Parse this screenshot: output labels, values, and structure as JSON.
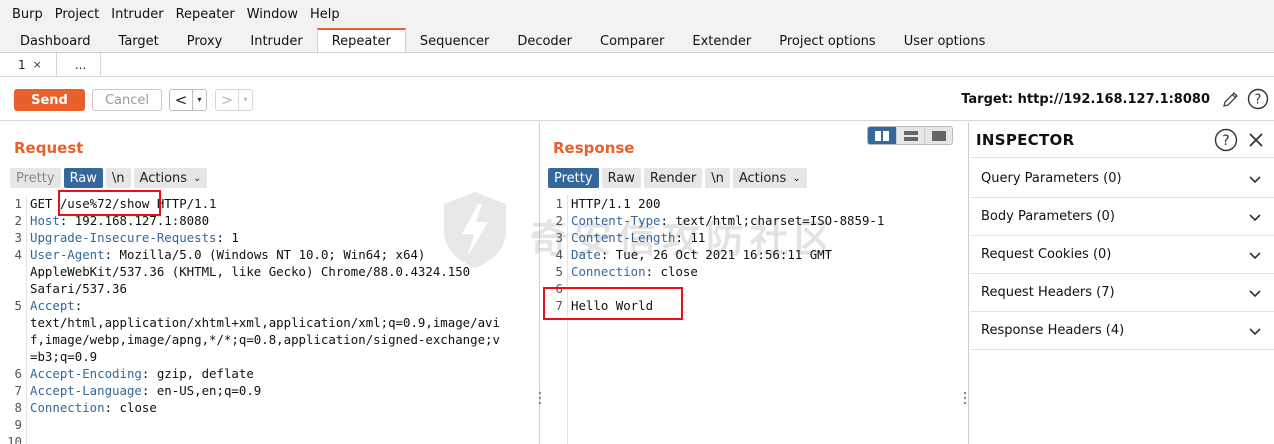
{
  "menu": [
    "Burp",
    "Project",
    "Intruder",
    "Repeater",
    "Window",
    "Help"
  ],
  "tabs": [
    "Dashboard",
    "Target",
    "Proxy",
    "Intruder",
    "Repeater",
    "Sequencer",
    "Decoder",
    "Comparer",
    "Extender",
    "Project options",
    "User options"
  ],
  "active_tab": "Repeater",
  "subtabs": {
    "first": "1",
    "close": "×",
    "more": "..."
  },
  "toolbar": {
    "send": "Send",
    "cancel": "Cancel",
    "back": "<",
    "forward": ">",
    "dropdown": "▾",
    "target": "Target: http://192.168.127.1:8080"
  },
  "request": {
    "title": "Request",
    "views": [
      "Pretty",
      "Raw",
      "\\n",
      "Actions"
    ],
    "selected_view": "Raw",
    "lines": [
      {
        "n": "1",
        "text": "GET /use%72/show HTTP/1.1"
      },
      {
        "n": "2",
        "key": "Host",
        "val": " 192.168.127.1:8080"
      },
      {
        "n": "3",
        "key": "Upgrade-Insecure-Requests",
        "val": " 1"
      },
      {
        "n": "4",
        "key": "User-Agent",
        "val": " Mozilla/5.0 (Windows NT 10.0; Win64; x64)"
      },
      {
        "n": "",
        "text": "AppleWebKit/537.36 (KHTML, like Gecko) Chrome/88.0.4324.150"
      },
      {
        "n": "",
        "text": "Safari/537.36"
      },
      {
        "n": "5",
        "key": "Accept",
        "val": ""
      },
      {
        "n": "",
        "text": "text/html,application/xhtml+xml,application/xml;q=0.9,image/avi"
      },
      {
        "n": "",
        "text": "f,image/webp,image/apng,*/*;q=0.8,application/signed-exchange;v"
      },
      {
        "n": "",
        "text": "=b3;q=0.9"
      },
      {
        "n": "6",
        "key": "Accept-Encoding",
        "val": " gzip, deflate"
      },
      {
        "n": "7",
        "key": "Accept-Language",
        "val": " en-US,en;q=0.9"
      },
      {
        "n": "8",
        "key": "Connection",
        "val": " close"
      },
      {
        "n": "9",
        "text": ""
      },
      {
        "n": "10",
        "text": ""
      }
    ]
  },
  "response": {
    "title": "Response",
    "views": [
      "Pretty",
      "Raw",
      "Render",
      "\\n",
      "Actions"
    ],
    "selected_view": "Pretty",
    "lines": [
      {
        "n": "1",
        "text": "HTTP/1.1 200"
      },
      {
        "n": "2",
        "key": "Content-Type",
        "val": " text/html;charset=ISO-8859-1"
      },
      {
        "n": "3",
        "key": "Content-Length",
        "val": " 11"
      },
      {
        "n": "4",
        "key": "Date",
        "val": " Tue, 26 Oct 2021 16:56:11 GMT"
      },
      {
        "n": "5",
        "key": "Connection",
        "val": " close"
      },
      {
        "n": "6",
        "text": ""
      },
      {
        "n": "7",
        "text": "Hello World"
      }
    ]
  },
  "inspector": {
    "title": "INSPECTOR",
    "sections": [
      "Query Parameters (0)",
      "Body Parameters (0)",
      "Request Cookies (0)",
      "Request Headers (7)",
      "Response Headers (4)"
    ]
  },
  "watermark": "奇安信攻防社区",
  "colors": {
    "accent": "#e8612c",
    "selected": "#34689b",
    "header_key": "#34689b",
    "highlight_box": "#e8101c"
  }
}
